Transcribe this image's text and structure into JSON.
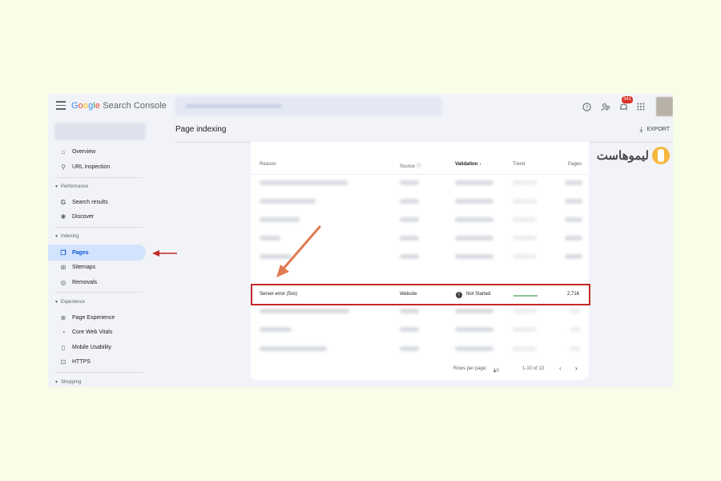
{
  "app": {
    "logo_parts": [
      "G",
      "o",
      "o",
      "g",
      "l",
      "e"
    ],
    "logo_rest": " Search Console",
    "notification_count": "341"
  },
  "sidebar": {
    "items": [
      {
        "label": "Overview",
        "icon": "home-icon",
        "glyph": "⌂"
      },
      {
        "label": "URL inspection",
        "icon": "search-icon",
        "glyph": "⚲"
      },
      {
        "label": "Search results",
        "icon": "google-g-icon",
        "glyph": "G"
      },
      {
        "label": "Discover",
        "icon": "asterisk-icon",
        "glyph": "✱"
      },
      {
        "label": "Pages",
        "icon": "pages-icon",
        "glyph": "❐"
      },
      {
        "label": "Sitemaps",
        "icon": "sitemap-icon",
        "glyph": "⊞"
      },
      {
        "label": "Removals",
        "icon": "eye-off-icon",
        "glyph": "◎"
      },
      {
        "label": "Page Experience",
        "icon": "plus-circle-icon",
        "glyph": "⊕"
      },
      {
        "label": "Core Web Vitals",
        "icon": "gauge-icon",
        "glyph": "◔"
      },
      {
        "label": "Mobile Usability",
        "icon": "phone-icon",
        "glyph": "▯"
      },
      {
        "label": "HTTPS",
        "icon": "lock-icon",
        "glyph": "⊡"
      }
    ],
    "sections": {
      "performance": "Performance",
      "indexing": "Indexing",
      "experience": "Experience",
      "shopping": "Shopping"
    },
    "active": "Pages"
  },
  "header": {
    "title": "Page indexing",
    "export_label": "EXPORT"
  },
  "watermark": {
    "text": "لیموهاست"
  },
  "table": {
    "columns": {
      "reason": "Reason",
      "source": "Source",
      "validation": "Validation",
      "trend": "Trend",
      "pages": "Pages"
    },
    "highlighted_row": {
      "reason": "Server error (5xx)",
      "source": "Website",
      "validation": "Not Started",
      "pages": "2,716"
    },
    "pagination": {
      "rows_per_page_label": "Rows per page:",
      "rows_per_page": "10",
      "range": "1-10 of 13"
    }
  },
  "colors": {
    "page_background": "#f7fde6",
    "highlight_border": "#c62828",
    "arrow": "#e07a52",
    "active_nav": "#d3e3fd"
  }
}
